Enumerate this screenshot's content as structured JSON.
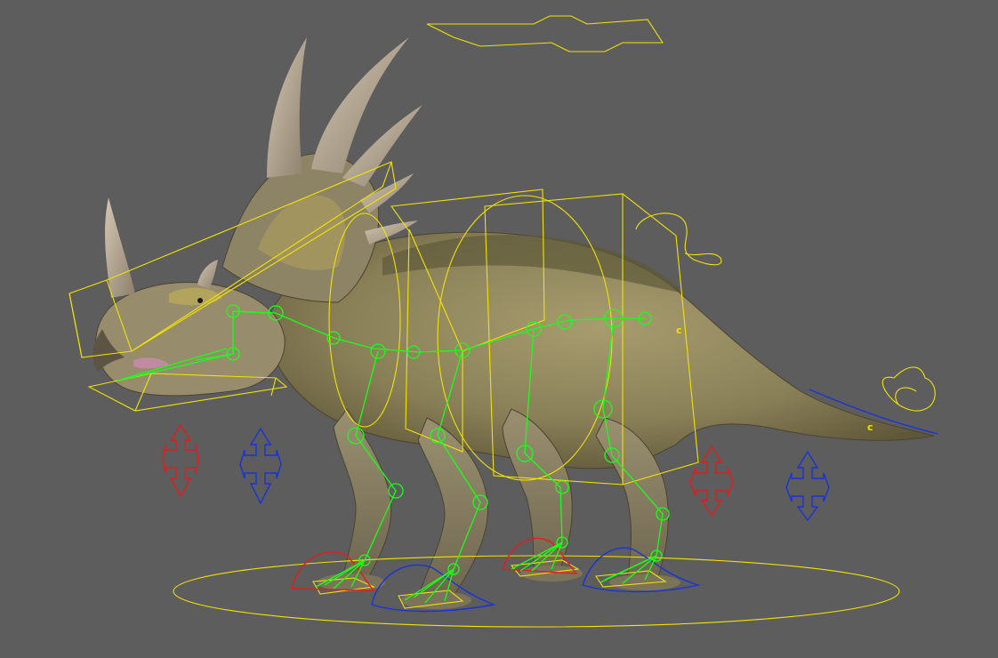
{
  "viewport": {
    "background": "#5d5d5d",
    "colors": {
      "controls": "#f2e300",
      "joints": "#19ff19",
      "left_side": "#e21d1d",
      "right_side": "#1a33d6",
      "body_fill": "#9c9166",
      "body_dark": "#6e6440",
      "horn": "#b8ab96"
    },
    "labels": {
      "spine_tag": "c",
      "tail_tag": "c"
    },
    "icons": [
      "move-arrows-icon",
      "curve-loop-icon",
      "master-move-icon"
    ]
  }
}
